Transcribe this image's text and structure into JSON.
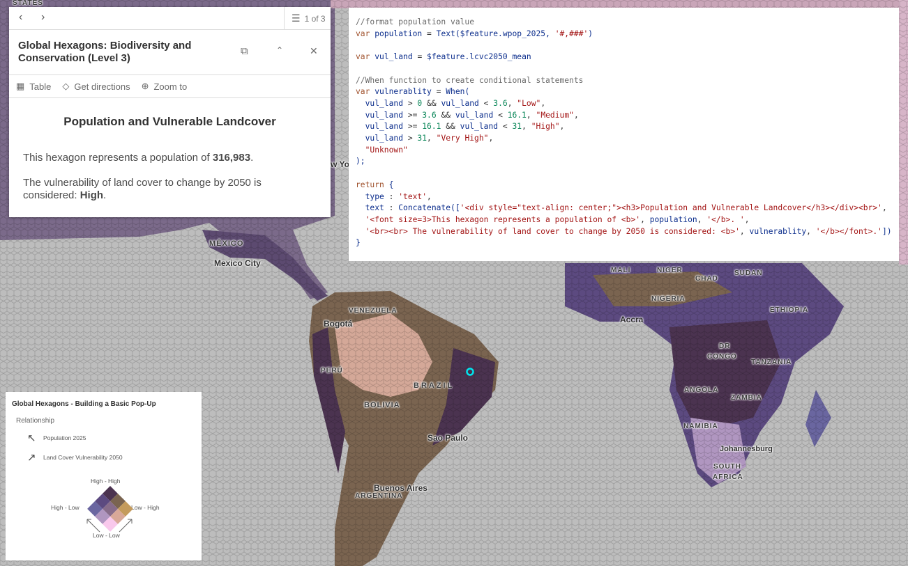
{
  "map": {
    "labels": [
      {
        "text": "STATES",
        "type": "region"
      },
      {
        "text": "MÉXICO",
        "type": "region"
      },
      {
        "text": "Mexico City",
        "type": "city"
      },
      {
        "text": "w Yo",
        "type": "city"
      },
      {
        "text": "VENEZUELA",
        "type": "region"
      },
      {
        "text": "Bogotá",
        "type": "city"
      },
      {
        "text": "PERÚ",
        "type": "region"
      },
      {
        "text": "BRAZIL",
        "type": "region"
      },
      {
        "text": "BOLIVIA",
        "type": "region"
      },
      {
        "text": "Sao Paulo",
        "type": "city"
      },
      {
        "text": "Buenos Aires",
        "type": "city"
      },
      {
        "text": "ARGENTINA",
        "type": "region"
      },
      {
        "text": "MALI",
        "type": "region"
      },
      {
        "text": "NIGER",
        "type": "region"
      },
      {
        "text": "SUDAN",
        "type": "region"
      },
      {
        "text": "CHAD",
        "type": "region"
      },
      {
        "text": "NIGERIA",
        "type": "region"
      },
      {
        "text": "ETHIOPIA",
        "type": "region"
      },
      {
        "text": "Accra",
        "type": "city"
      },
      {
        "text": "DR",
        "type": "region"
      },
      {
        "text": "CONGO",
        "type": "region"
      },
      {
        "text": "TANZANIA",
        "type": "region"
      },
      {
        "text": "ANGOLA",
        "type": "region"
      },
      {
        "text": "ZAMBIA",
        "type": "region"
      },
      {
        "text": "NAMIBIA",
        "type": "region"
      },
      {
        "text": "Johannesburg",
        "type": "city"
      },
      {
        "text": "SOUTH",
        "type": "region"
      },
      {
        "text": "AFRICA",
        "type": "region"
      }
    ],
    "selection_color": "#00e5ee"
  },
  "popup": {
    "feature_count": "1 of 3",
    "title": "Global Hexagons: Biodiversity and Conservation (Level 3)",
    "actions": [
      {
        "label": "Table",
        "icon": "table-icon"
      },
      {
        "label": "Get directions",
        "icon": "directions-icon"
      },
      {
        "label": "Zoom to",
        "icon": "zoom-to-icon"
      }
    ],
    "heading": "Population and Vulnerable Landcover",
    "pop_prefix": "This hexagon represents a population of ",
    "pop_value": "316,983",
    "pop_suffix": ".",
    "vul_prefix": "The vulnerability of land cover to change by 2050 is considered: ",
    "vul_value": "High",
    "vul_suffix": "."
  },
  "code": {
    "lines": [
      [
        [
          "comment",
          "//format population value"
        ]
      ],
      [
        [
          "kw",
          "var "
        ],
        [
          "id",
          "population"
        ],
        [
          "plain",
          " = "
        ],
        [
          "id",
          "Text($feature.wpop_2025, "
        ],
        [
          "str",
          "'#,###'"
        ],
        [
          "id",
          ")"
        ]
      ],
      [],
      [
        [
          "kw",
          "var "
        ],
        [
          "id",
          "vul_land"
        ],
        [
          "plain",
          " = "
        ],
        [
          "id",
          "$feature.lcvc2050_mean"
        ]
      ],
      [],
      [
        [
          "comment",
          "//When function to create conditional statements"
        ]
      ],
      [
        [
          "kw",
          "var "
        ],
        [
          "id",
          "vulnerablity"
        ],
        [
          "plain",
          " = "
        ],
        [
          "id",
          "When("
        ]
      ],
      [
        [
          "id",
          "  vul_land"
        ],
        [
          "plain",
          " > "
        ],
        [
          "num",
          "0"
        ],
        [
          "plain",
          " && "
        ],
        [
          "id",
          "vul_land"
        ],
        [
          "plain",
          " < "
        ],
        [
          "num",
          "3.6"
        ],
        [
          "plain",
          ", "
        ],
        [
          "str",
          "\"Low\""
        ],
        [
          "plain",
          ","
        ]
      ],
      [
        [
          "id",
          "  vul_land"
        ],
        [
          "plain",
          " >= "
        ],
        [
          "num",
          "3.6"
        ],
        [
          "plain",
          " && "
        ],
        [
          "id",
          "vul_land"
        ],
        [
          "plain",
          " < "
        ],
        [
          "num",
          "16.1"
        ],
        [
          "plain",
          ", "
        ],
        [
          "str",
          "\"Medium\""
        ],
        [
          "plain",
          ","
        ]
      ],
      [
        [
          "id",
          "  vul_land"
        ],
        [
          "plain",
          " >= "
        ],
        [
          "num",
          "16.1"
        ],
        [
          "plain",
          " && "
        ],
        [
          "id",
          "vul_land"
        ],
        [
          "plain",
          " < "
        ],
        [
          "num",
          "31"
        ],
        [
          "plain",
          ", "
        ],
        [
          "str",
          "\"High\""
        ],
        [
          "plain",
          ","
        ]
      ],
      [
        [
          "id",
          "  vul_land"
        ],
        [
          "plain",
          " > "
        ],
        [
          "num",
          "31"
        ],
        [
          "plain",
          ", "
        ],
        [
          "str",
          "\"Very High\""
        ],
        [
          "plain",
          ","
        ]
      ],
      [
        [
          "str",
          "  \"Unknown\""
        ]
      ],
      [
        [
          "id",
          ");"
        ]
      ],
      [],
      [
        [
          "kw",
          "return "
        ],
        [
          "id",
          "{"
        ]
      ],
      [
        [
          "id",
          "  type"
        ],
        [
          "plain",
          " : "
        ],
        [
          "str",
          "'text'"
        ],
        [
          "plain",
          ","
        ]
      ],
      [
        [
          "id",
          "  text"
        ],
        [
          "plain",
          " : "
        ],
        [
          "id",
          "Concatenate(["
        ],
        [
          "str",
          "'<div style=\"text-align: center;\"><h3>Population and Vulnerable Landcover</h3></div><br>'"
        ],
        [
          "plain",
          ","
        ]
      ],
      [
        [
          "str",
          "  '<font size=3>This hexagon represents a population of <b>'"
        ],
        [
          "plain",
          ", "
        ],
        [
          "id",
          "population"
        ],
        [
          "plain",
          ", "
        ],
        [
          "str",
          "'</b>. '"
        ],
        [
          "plain",
          ","
        ]
      ],
      [
        [
          "str",
          "  '<br><br> The vulnerability of land cover to change by 2050 is considered: <b>'"
        ],
        [
          "plain",
          ", "
        ],
        [
          "id",
          "vulnerablity"
        ],
        [
          "plain",
          ", "
        ],
        [
          "str",
          "'</b></font>.'"
        ],
        [
          "id",
          "])"
        ]
      ],
      [
        [
          "id",
          "}"
        ]
      ]
    ]
  },
  "legend": {
    "title": "Global Hexagons - Building a Basic Pop-Up",
    "subtitle": "Relationship",
    "field1": "Population 2025",
    "field2": "Land Cover Vulnerability 2050",
    "corner_top": "High - High",
    "corner_left": "High - Low",
    "corner_right": "Low - High",
    "corner_bottom": "Low - Low",
    "colors": [
      [
        "#4b3350",
        "#7a6450",
        "#c49b5c"
      ],
      [
        "#5c4a80",
        "#876c8a",
        "#d8a898"
      ],
      [
        "#6a66a0",
        "#b096c0",
        "#f9c8ec"
      ]
    ]
  }
}
